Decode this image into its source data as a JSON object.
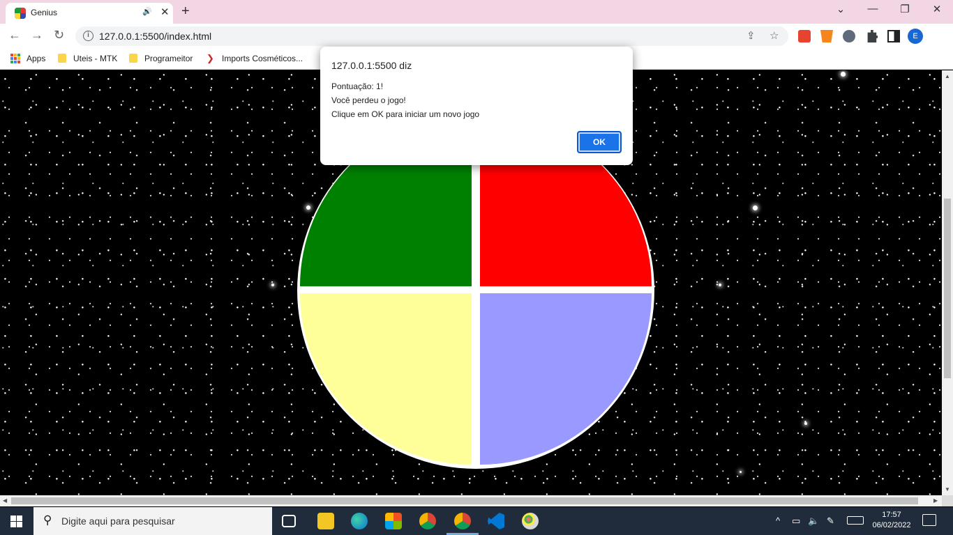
{
  "browser": {
    "tab_title": "Genius",
    "audio_glyph": "🔊",
    "close_glyph": "✕",
    "newtab_glyph": "+",
    "window_controls": [
      "⌄",
      "—",
      "❐",
      "✕"
    ],
    "nav": {
      "back": "←",
      "forward": "→",
      "reload": "↻"
    },
    "url": "127.0.0.1:5500/index.html",
    "info_glyph": "i",
    "share_glyph": "⇪",
    "star_glyph": "☆",
    "profile_initial": "E"
  },
  "bookmarks": [
    {
      "label": "Apps",
      "icon": "apps-grid-icon"
    },
    {
      "label": "Uteis - MTK",
      "icon": "folder-icon"
    },
    {
      "label": "Programeitor",
      "icon": "folder-icon"
    },
    {
      "label": "Imports Cosméticos...",
      "icon": "site-favicon"
    }
  ],
  "dialog": {
    "title": "127.0.0.1:5500 diz",
    "line1": "Pontuação: 1!",
    "line2": "Você perdeu o jogo!",
    "line3": "Clique em OK para iniciar um novo jogo",
    "ok_label": "OK"
  },
  "game": {
    "colors": {
      "green": "#008000",
      "red": "#ff0000",
      "yellow": "#ffff99",
      "blue": "#9999ff"
    }
  },
  "taskbar": {
    "search_placeholder": "Digite aqui para pesquisar",
    "apps": [
      "task-view-icon",
      "file-explorer-icon",
      "edge-icon",
      "store-icon",
      "chrome-icon",
      "chrome-dev-icon",
      "vscode-icon",
      "paint-icon"
    ],
    "tray_glyphs": {
      "up": "^",
      "battery": "▭",
      "volume": "🔈",
      "pen": "✎"
    },
    "time": "17:57",
    "date": "06/02/2022"
  },
  "scrollbars": {
    "up": "▲",
    "down": "▼",
    "left": "◀",
    "right": "▶"
  }
}
